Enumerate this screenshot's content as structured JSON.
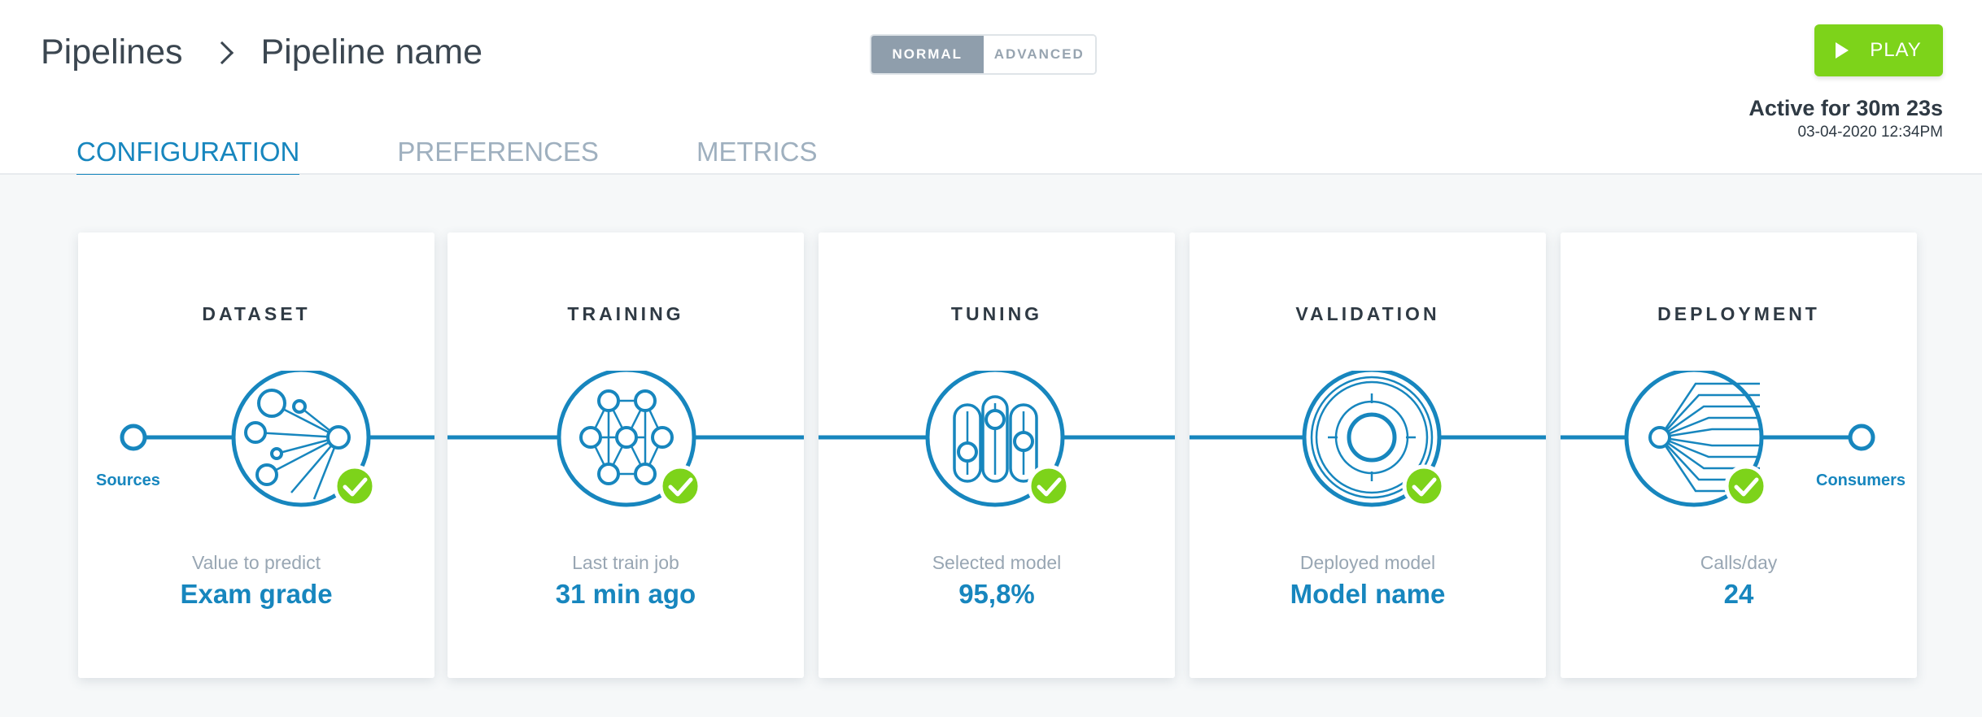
{
  "breadcrumb": {
    "root": "Pipelines",
    "current": "Pipeline name"
  },
  "mode_toggle": {
    "normal": "NORMAL",
    "advanced": "ADVANCED",
    "selected": "NORMAL"
  },
  "play_button": {
    "label": "PLAY",
    "icon": "play-icon"
  },
  "status": {
    "active_for": "Active for 30m 23s",
    "date": "03-04-2020 12:34PM"
  },
  "tabs": [
    {
      "label": "CONFIGURATION",
      "active": true
    },
    {
      "label": "PREFERENCES",
      "active": false
    },
    {
      "label": "METRICS",
      "active": false
    }
  ],
  "pipeline": {
    "sources_label": "Sources",
    "consumers_label": "Consumers",
    "stages": [
      {
        "title": "DATASET",
        "label": "Value to predict",
        "value": "Exam grade",
        "icon": "dataset-icon",
        "complete": true
      },
      {
        "title": "TRAINING",
        "label": "Last train job",
        "value": "31 min ago",
        "icon": "neural-network-icon",
        "complete": true
      },
      {
        "title": "TUNING",
        "label": "Selected model",
        "value": "95,8%",
        "icon": "sliders-icon",
        "complete": true
      },
      {
        "title": "VALIDATION",
        "label": "Deployed model",
        "value": "Model name",
        "icon": "target-icon",
        "complete": true
      },
      {
        "title": "DEPLOYMENT",
        "label": "Calls/day",
        "value": "24",
        "icon": "deployment-fan-icon",
        "complete": true
      }
    ]
  },
  "colors": {
    "accent": "#1786be",
    "success": "#7dd31a",
    "toggle_active": "#8f9eac"
  }
}
